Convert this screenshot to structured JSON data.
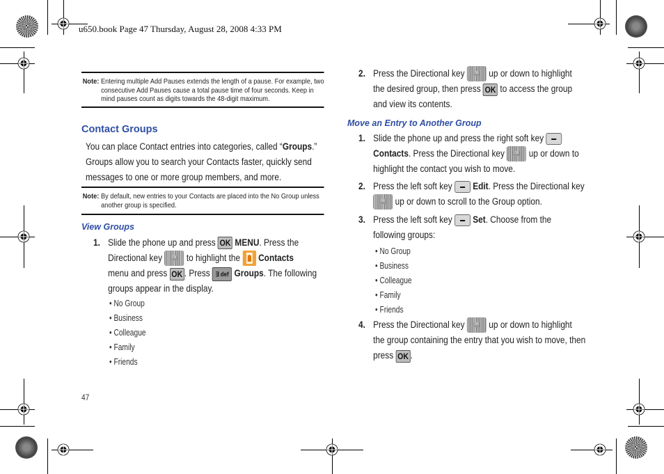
{
  "header": {
    "slug": "u650.book  Page 47  Thursday, August 28, 2008  4:33 PM"
  },
  "left": {
    "note1": {
      "label": "Note:",
      "text": "Entering multiple Add Pauses extends the length of a pause. For example, two consecutive Add Pauses cause a total pause time of four seconds. Keep in mind pauses count as digits towards the 48-digit maximum."
    },
    "heading": "Contact Groups",
    "intro": {
      "line1a": "You can place Contact entries into categories, called “",
      "line1b": "Groups",
      "line1c": ".”",
      "line2": "Groups allow you to search your Contacts faster, quickly send",
      "line3": "messages to one or more group members, and more."
    },
    "note2": {
      "label": "Note:",
      "text": "By default, new entries to your Contacts are placed into the No Group unless another group is specified."
    },
    "subheading": "View Groups",
    "step1": {
      "num": "1.",
      "a": "Slide the phone up and press",
      "menu": "MENU",
      "b": ". Press the",
      "c": "Directional key",
      "d": "to highlight the",
      "contacts": "Contacts",
      "e": "menu and press",
      "f": ". Press",
      "groups": "Groups",
      "g": ". The following",
      "h": "groups appear in the display."
    },
    "bullets": [
      "No Group",
      "Business",
      "Colleague",
      "Family",
      "Friends"
    ],
    "page_number": "47"
  },
  "right": {
    "step2": {
      "num": "2.",
      "a": "Press the Directional key",
      "b": "up or down to highlight",
      "c": "the desired group, then press",
      "d": "to access the group",
      "e": "and view its contents."
    },
    "subheading": "Move an Entry to Another Group",
    "m1": {
      "num": "1.",
      "a": "Slide the phone up and press the right soft key",
      "contacts": "Contacts",
      "b": ". Press the Directional key",
      "c": "up or down to",
      "d": "highlight the contact you wish to move."
    },
    "m2": {
      "num": "2.",
      "a": "Press the left soft key",
      "edit": "Edit",
      "b": ". Press the Directional key",
      "c": "up or down to scroll to the Group option."
    },
    "m3": {
      "num": "3.",
      "a": "Press the left soft key",
      "set": "Set",
      "b": ". Choose from the",
      "c": "following groups:"
    },
    "bullets": [
      "No Group",
      "Business",
      "Colleague",
      "Family",
      "Friends"
    ],
    "m4": {
      "num": "4.",
      "a": "Press the Directional key",
      "b": "up or down to highlight",
      "c": "the group containing the entry that you wish to move, then",
      "d": "press",
      "e": "."
    }
  },
  "keys": {
    "ok": "OK",
    "three": "∃ def",
    "dir_center": "OK"
  }
}
